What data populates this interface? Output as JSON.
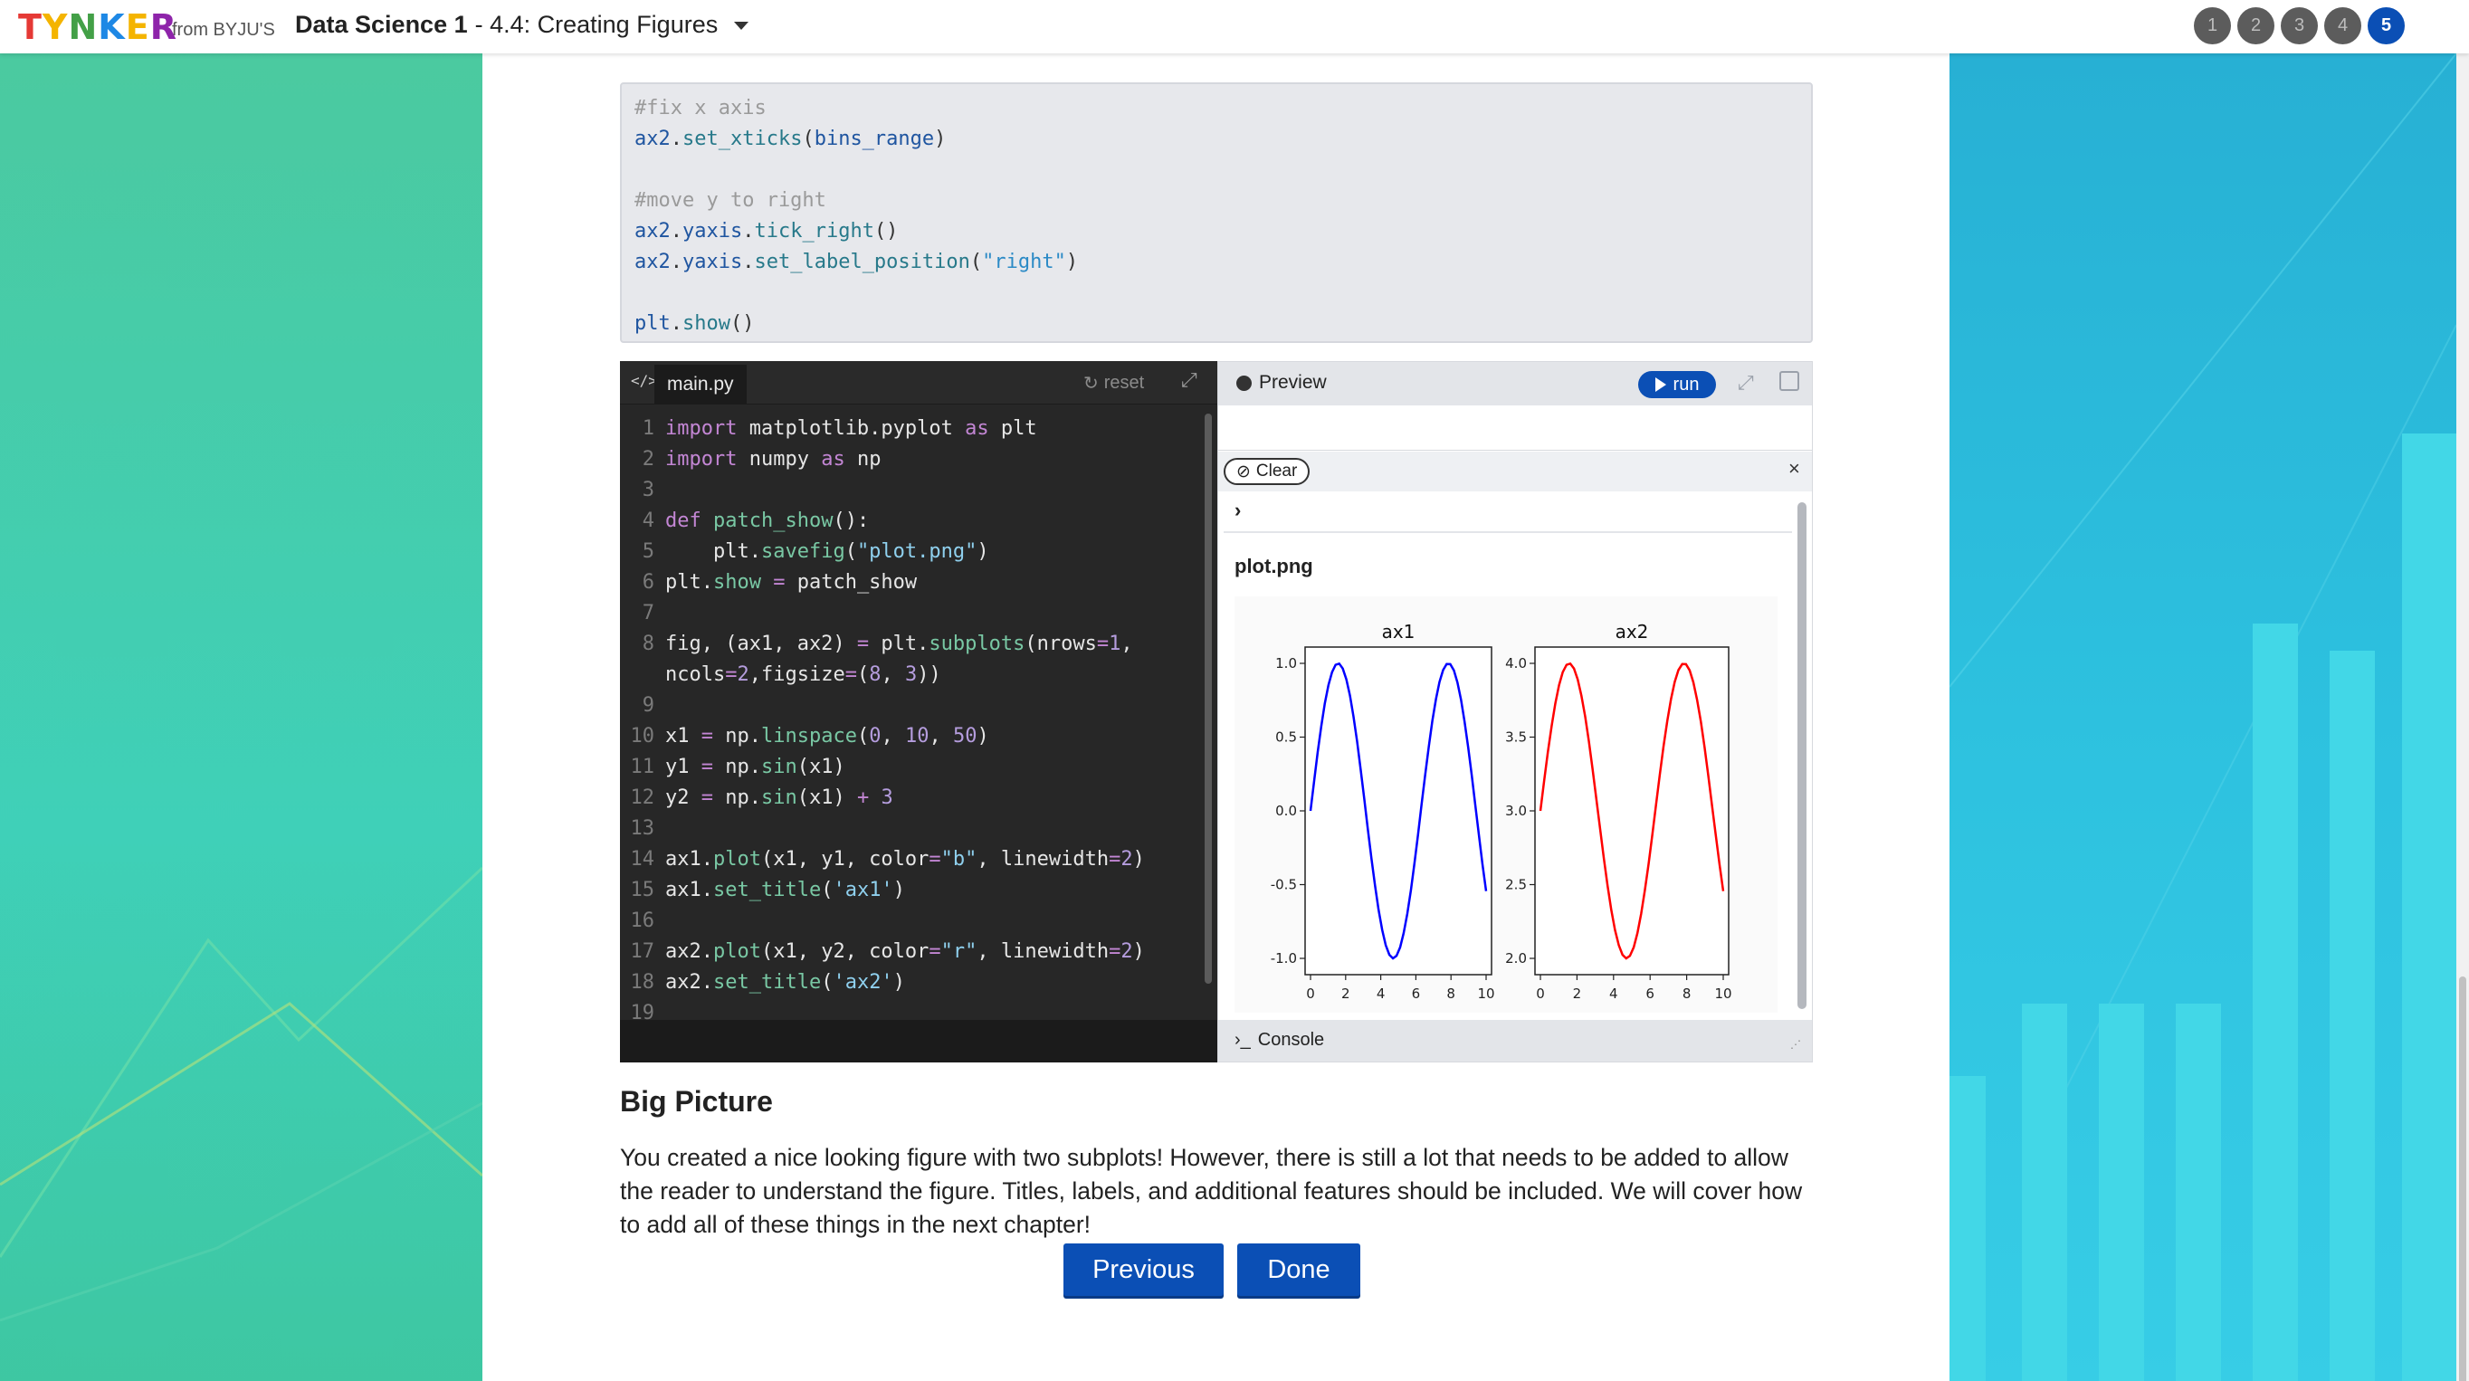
{
  "topbar": {
    "logo_letters": [
      "T",
      "Y",
      "N",
      "K",
      "E",
      "R"
    ],
    "logo_colors": [
      "#e53935",
      "#f4b400",
      "#43a047",
      "#1e88e5",
      "#f4b400",
      "#8e24aa"
    ],
    "from_text": "from BYJU'S",
    "course_main": "Data Science 1",
    "course_sub": " - 4.4: Creating Figures",
    "steps": [
      "1",
      "2",
      "3",
      "4",
      "5"
    ],
    "active_step": "5"
  },
  "code_block": {
    "lines": [
      {
        "t": "comment",
        "v": "#fix x axis"
      },
      {
        "t": "code",
        "obj": "ax2",
        "fn": "set_xticks",
        "args": "bins_range",
        "str": ""
      },
      {
        "t": "blank",
        "v": ""
      },
      {
        "t": "comment",
        "v": "#move y to right"
      },
      {
        "t": "code2",
        "v": "ax2.yaxis.tick_right()"
      },
      {
        "t": "code3",
        "v1": "ax2.yaxis.set_label_position(",
        "v2": "\"right\"",
        "v3": ")"
      },
      {
        "t": "blank",
        "v": ""
      },
      {
        "t": "code4",
        "v": "plt.show()"
      }
    ]
  },
  "editor": {
    "file_tab": "main.py",
    "reset_label": "reset",
    "line_numbers": [
      "1",
      "2",
      "3",
      "4",
      "5",
      "6",
      "7",
      "8",
      "",
      "9",
      "10",
      "11",
      "12",
      "13",
      "14",
      "15",
      "16",
      "17",
      "18",
      "19"
    ],
    "lines": [
      [
        [
          "kw",
          "import"
        ],
        [
          "p",
          " matplotlib.pyplot "
        ],
        [
          "kw",
          "as"
        ],
        [
          "p",
          " plt"
        ]
      ],
      [
        [
          "kw",
          "import"
        ],
        [
          "p",
          " numpy "
        ],
        [
          "kw",
          "as"
        ],
        [
          "p",
          " np"
        ]
      ],
      [],
      [
        [
          "kw",
          "def"
        ],
        [
          "p",
          " "
        ],
        [
          "fnc",
          "patch_show"
        ],
        [
          "p",
          "():"
        ]
      ],
      [
        [
          "p",
          "    plt."
        ],
        [
          "fnc",
          "savefig"
        ],
        [
          "p",
          "("
        ],
        [
          "str",
          "\"plot.png\""
        ],
        [
          "p",
          ")"
        ]
      ],
      [
        [
          "p",
          "plt."
        ],
        [
          "fnc",
          "show"
        ],
        [
          "p",
          " "
        ],
        [
          "kw",
          "="
        ],
        [
          "p",
          " patch_show"
        ]
      ],
      [],
      [
        [
          "p",
          "fig, (ax1, ax2) "
        ],
        [
          "kw",
          "="
        ],
        [
          "p",
          " plt."
        ],
        [
          "fnc",
          "subplots"
        ],
        [
          "p",
          "(nrows"
        ],
        [
          "kw",
          "="
        ],
        [
          "num",
          "1"
        ],
        [
          "p",
          ","
        ]
      ],
      [
        [
          "p",
          "ncols"
        ],
        [
          "kw",
          "="
        ],
        [
          "num",
          "2"
        ],
        [
          "p",
          ",figsize"
        ],
        [
          "kw",
          "="
        ],
        [
          "p",
          "("
        ],
        [
          "num",
          "8"
        ],
        [
          "p",
          ", "
        ],
        [
          "num",
          "3"
        ],
        [
          "p",
          "))"
        ]
      ],
      [],
      [
        [
          "p",
          "x1 "
        ],
        [
          "kw",
          "="
        ],
        [
          "p",
          " np."
        ],
        [
          "fnc",
          "linspace"
        ],
        [
          "p",
          "("
        ],
        [
          "num",
          "0"
        ],
        [
          "p",
          ", "
        ],
        [
          "num",
          "10"
        ],
        [
          "p",
          ", "
        ],
        [
          "num",
          "50"
        ],
        [
          "p",
          ")"
        ]
      ],
      [
        [
          "p",
          "y1 "
        ],
        [
          "kw",
          "="
        ],
        [
          "p",
          " np."
        ],
        [
          "fnc",
          "sin"
        ],
        [
          "p",
          "(x1)"
        ]
      ],
      [
        [
          "p",
          "y2 "
        ],
        [
          "kw",
          "="
        ],
        [
          "p",
          " np."
        ],
        [
          "fnc",
          "sin"
        ],
        [
          "p",
          "(x1) "
        ],
        [
          "kw",
          "+"
        ],
        [
          "p",
          " "
        ],
        [
          "num",
          "3"
        ]
      ],
      [],
      [
        [
          "p",
          "ax1."
        ],
        [
          "fnc",
          "plot"
        ],
        [
          "p",
          "(x1, y1, color"
        ],
        [
          "kw",
          "="
        ],
        [
          "str",
          "\"b\""
        ],
        [
          "p",
          ", linewidth"
        ],
        [
          "kw",
          "="
        ],
        [
          "num",
          "2"
        ],
        [
          "p",
          ")"
        ]
      ],
      [
        [
          "p",
          "ax1."
        ],
        [
          "fnc",
          "set_title"
        ],
        [
          "p",
          "("
        ],
        [
          "str",
          "'ax1'"
        ],
        [
          "p",
          ")"
        ]
      ],
      [],
      [
        [
          "p",
          "ax2."
        ],
        [
          "fnc",
          "plot"
        ],
        [
          "p",
          "(x1, y2, color"
        ],
        [
          "kw",
          "="
        ],
        [
          "str",
          "\"r\""
        ],
        [
          "p",
          ", linewidth"
        ],
        [
          "kw",
          "="
        ],
        [
          "num",
          "2"
        ],
        [
          "p",
          ")"
        ]
      ],
      [
        [
          "p",
          "ax2."
        ],
        [
          "fnc",
          "set_title"
        ],
        [
          "p",
          "("
        ],
        [
          "str",
          "'ax2'"
        ],
        [
          "p",
          ")"
        ]
      ],
      []
    ]
  },
  "preview": {
    "label": "Preview",
    "run_label": "run",
    "clear_label": "Clear",
    "close_glyph": "×",
    "prompt": "›",
    "output_file": "plot.png",
    "console_label": "Console"
  },
  "chart_data": [
    {
      "type": "line",
      "title": "ax1",
      "xlim": [
        0,
        10
      ],
      "ylim": [
        -1.0,
        1.0
      ],
      "xticks": [
        "0",
        "2",
        "4",
        "6",
        "8",
        "10"
      ],
      "yticks": [
        "1.0",
        "0.5",
        "0.0",
        "-0.5",
        "-1.0"
      ],
      "series": [
        {
          "color": "#0000ff",
          "formula": "sin(x), 50 points x=0..10",
          "x": [
            0,
            1,
            2,
            3,
            4,
            5,
            6,
            7,
            8,
            9,
            10
          ],
          "y": [
            0,
            0.84,
            0.91,
            0.14,
            -0.76,
            -0.96,
            -0.28,
            0.66,
            0.99,
            0.41,
            -0.54
          ]
        }
      ]
    },
    {
      "type": "line",
      "title": "ax2",
      "xlim": [
        0,
        10
      ],
      "ylim": [
        2.0,
        4.0
      ],
      "xticks": [
        "0",
        "2",
        "4",
        "6",
        "8",
        "10"
      ],
      "yticks": [
        "4.0",
        "3.5",
        "3.0",
        "2.5",
        "2.0"
      ],
      "series": [
        {
          "color": "#ff0000",
          "formula": "sin(x)+3, 50 points x=0..10",
          "x": [
            0,
            1,
            2,
            3,
            4,
            5,
            6,
            7,
            8,
            9,
            10
          ],
          "y": [
            3,
            3.84,
            3.91,
            3.14,
            2.24,
            2.04,
            2.72,
            3.66,
            3.99,
            3.41,
            2.46
          ]
        }
      ]
    }
  ],
  "article": {
    "section_title": "Big Picture",
    "paragraph": "You created a nice looking figure with two subplots! However, there is still a lot that needs to be added to allow the reader to understand the figure. Titles, labels, and additional features should be included. We will cover how to add all of these things in the next chapter!"
  },
  "nav": {
    "previous_label": "Previous",
    "done_label": "Done"
  }
}
